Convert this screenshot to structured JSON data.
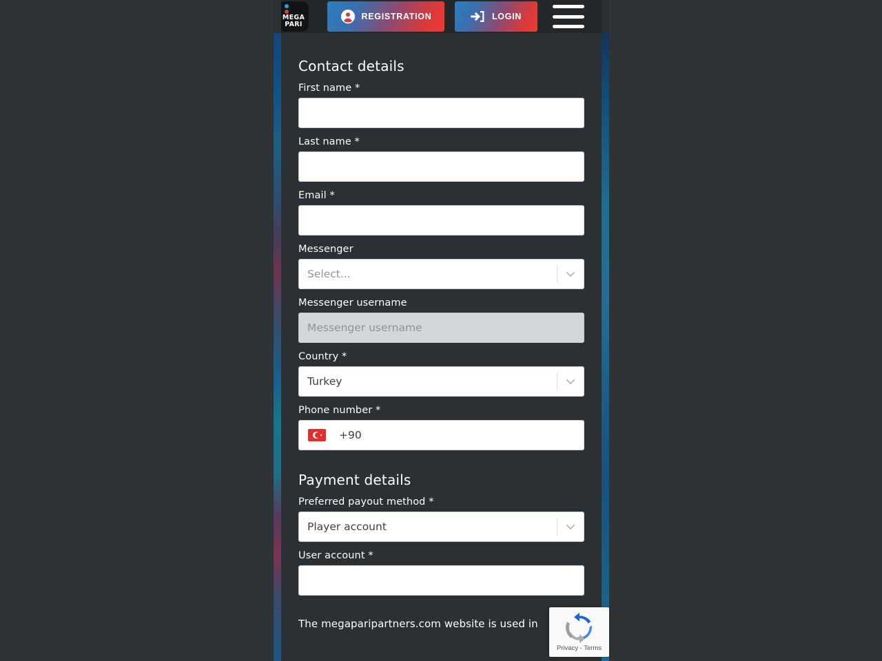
{
  "header": {
    "logo": {
      "line1": "MEGA",
      "line2": "PARI",
      "dot_blue": "#2f9fe0",
      "dot_red": "#e23a3a"
    },
    "registration_label": "REGISTRATION",
    "login_label": "LOGIN",
    "button_gradient_from": "#2a7fc0",
    "button_gradient_to": "#ee3b32"
  },
  "contact_section": {
    "title": "Contact details",
    "first_name": {
      "label": "First name *",
      "value": "",
      "placeholder": ""
    },
    "last_name": {
      "label": "Last name *",
      "value": "",
      "placeholder": ""
    },
    "email": {
      "label": "Email *",
      "value": "",
      "placeholder": ""
    },
    "messenger": {
      "label": "Messenger",
      "value": "Select..."
    },
    "messenger_username": {
      "label": "Messenger username",
      "value": "",
      "placeholder": "Messenger username",
      "disabled": true
    },
    "country": {
      "label": "Country *",
      "value": "Turkey"
    },
    "phone": {
      "label": "Phone number *",
      "dial_code": "+90",
      "flag": "turkey-flag"
    }
  },
  "payment_section": {
    "title": "Payment details",
    "payout_method": {
      "label": "Preferred payout method *",
      "value": "Player account"
    },
    "user_account": {
      "label": "User account *",
      "value": "",
      "placeholder": ""
    }
  },
  "footer": {
    "text": "The megaparipartners.com website is used in"
  },
  "recaptcha": {
    "links": "Privacy - Terms"
  }
}
